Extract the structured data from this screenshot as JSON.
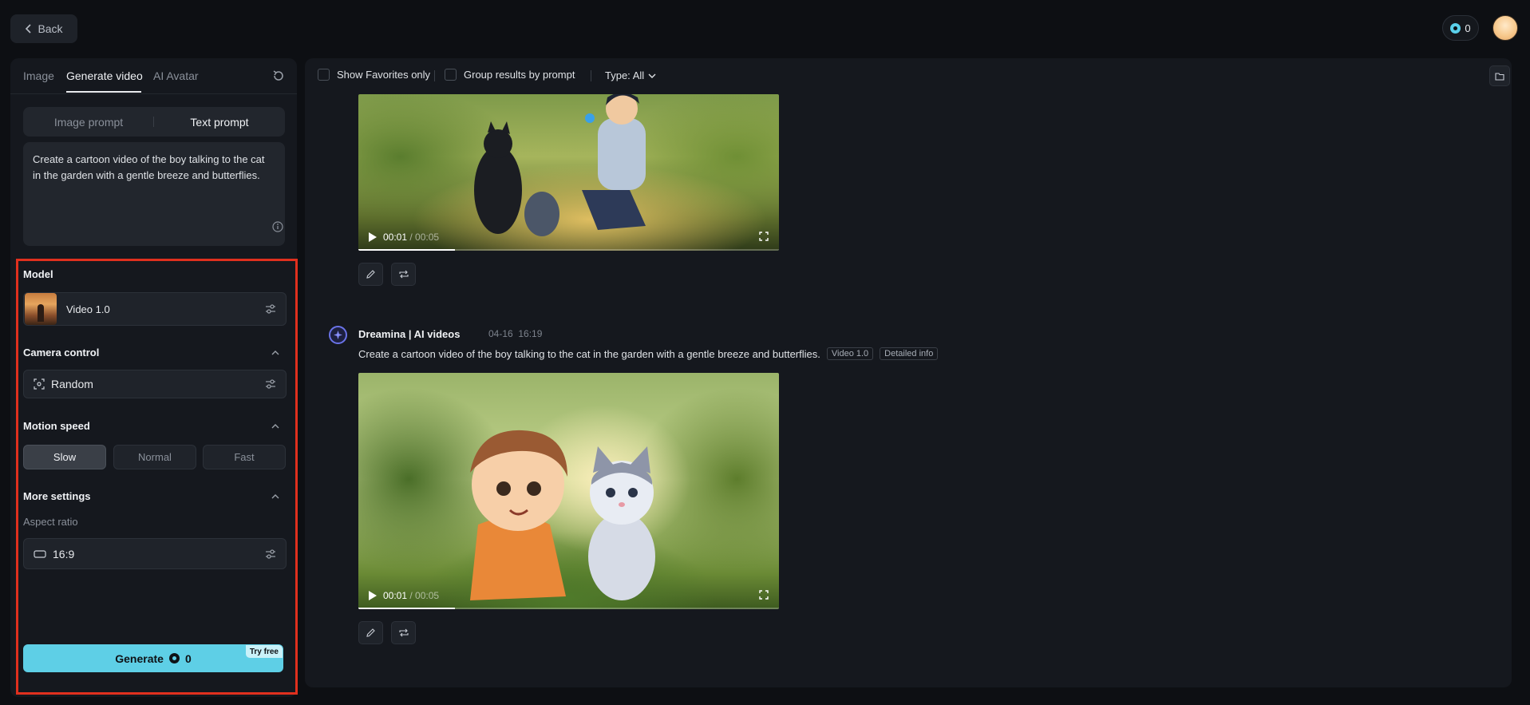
{
  "topbar": {
    "back_label": "Back",
    "credits": "0"
  },
  "left": {
    "tabs": [
      {
        "label": "Image"
      },
      {
        "label": "Generate video"
      },
      {
        "label": "AI Avatar"
      }
    ],
    "prompt_modes": [
      {
        "label": "Image prompt"
      },
      {
        "label": "Text prompt"
      }
    ],
    "prompt_text": "Create a cartoon video of the boy talking to the cat in the garden with a gentle breeze and butterflies.",
    "model": {
      "title": "Model",
      "value": "Video 1.0"
    },
    "camera": {
      "title": "Camera control",
      "value": "Random"
    },
    "motion": {
      "title": "Motion speed",
      "options": [
        {
          "label": "Slow",
          "selected": true
        },
        {
          "label": "Normal",
          "selected": false
        },
        {
          "label": "Fast",
          "selected": false
        }
      ]
    },
    "more": {
      "title": "More settings",
      "aspect_label": "Aspect ratio",
      "aspect_value": "16:9"
    },
    "generate": {
      "label": "Generate",
      "cost": "0",
      "badge": "Try free"
    }
  },
  "right": {
    "filters": {
      "favorites_label": "Show Favorites only",
      "group_label": "Group results by prompt",
      "type_label": "Type: All"
    },
    "videos": [
      {
        "time_current": "00:01",
        "time_total": "00:05"
      },
      {
        "time_current": "00:01",
        "time_total": "00:05"
      }
    ],
    "generation": {
      "author": "Dreamina | AI videos",
      "date": "04-16  16:19",
      "prompt": "Create a cartoon video of the boy talking to the cat in the garden with a gentle breeze and butterflies.",
      "model_tag": "Video 1.0",
      "info_tag": "Detailed info"
    }
  },
  "colors": {
    "accent": "#5ecfe6",
    "highlight_border": "#e0301e",
    "panel": "#15181e",
    "background": "#0d0f13"
  }
}
